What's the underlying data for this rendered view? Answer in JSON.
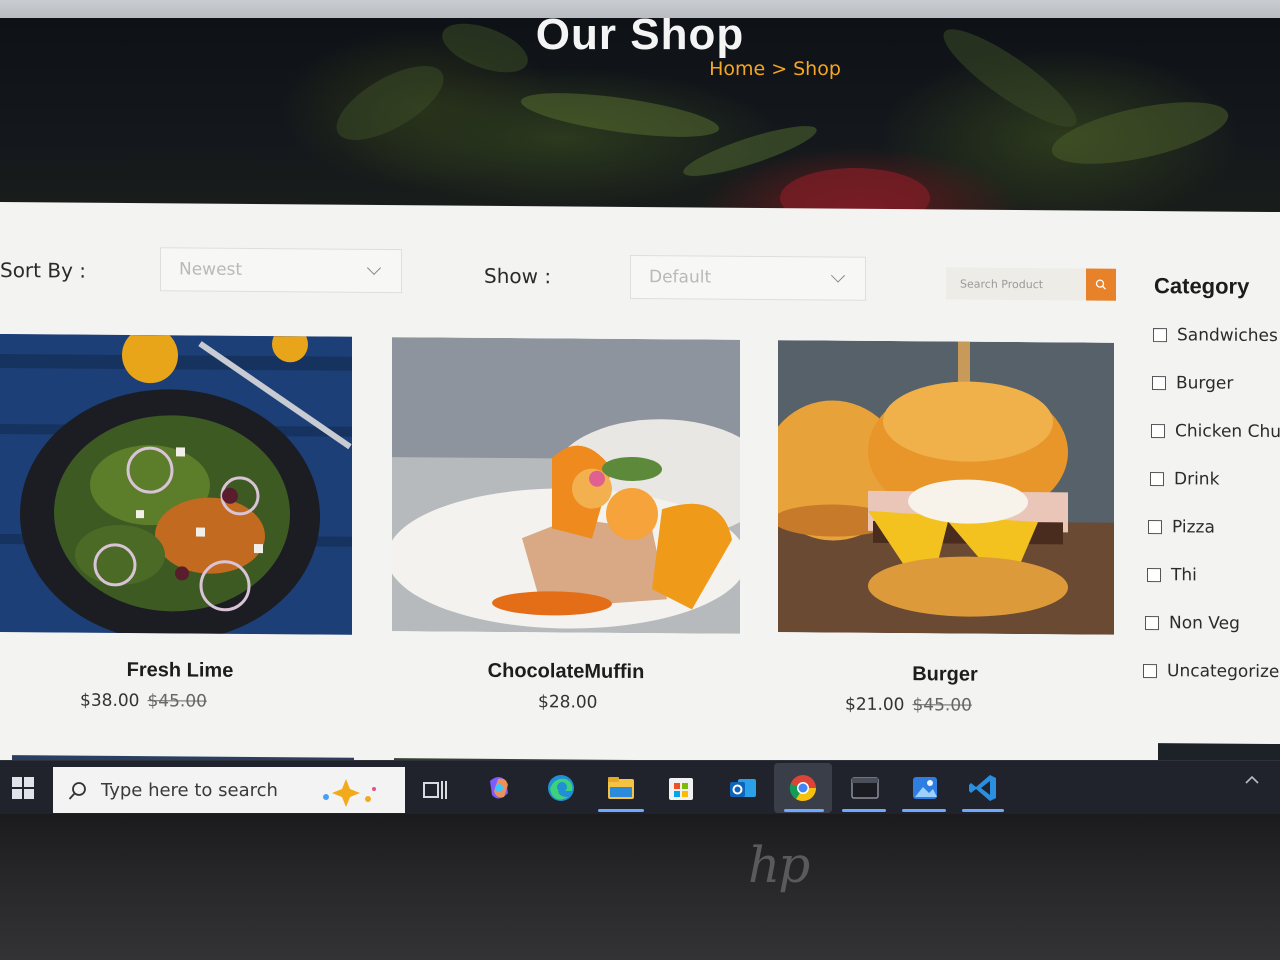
{
  "hero": {
    "title": "Our Shop",
    "breadcrumb": {
      "home": "Home",
      "separator": ">",
      "current": "Shop"
    }
  },
  "toolbar": {
    "sort_label": "Sort By :",
    "sort_value": "Newest",
    "show_label": "Show :",
    "show_value": "Default",
    "search_placeholder": "Search Product"
  },
  "category": {
    "title": "Category",
    "items": [
      "Sandwiches",
      "Burger",
      "Chicken Chup",
      "Drink",
      "Pizza",
      "Thi",
      "Non Veg",
      "Uncategorized"
    ]
  },
  "products": [
    {
      "name": "Fresh Lime",
      "price": "$38.00",
      "old_price": "$45.00"
    },
    {
      "name": "ChocolateMuffin",
      "price": "$28.00",
      "old_price": ""
    },
    {
      "name": "Burger",
      "price": "$21.00",
      "old_price": "$45.00"
    }
  ],
  "taskbar": {
    "search_placeholder": "Type here to search",
    "apps": [
      "task-view",
      "copilot",
      "edge",
      "file-explorer",
      "microsoft-store",
      "outlook",
      "chrome",
      "terminal",
      "photos",
      "vscode"
    ]
  },
  "device_logo": "hp",
  "colors": {
    "accent": "#f5a623",
    "search_button": "#e8822a",
    "page_bg": "#f3f3f1",
    "taskbar_bg": "#20232b"
  }
}
